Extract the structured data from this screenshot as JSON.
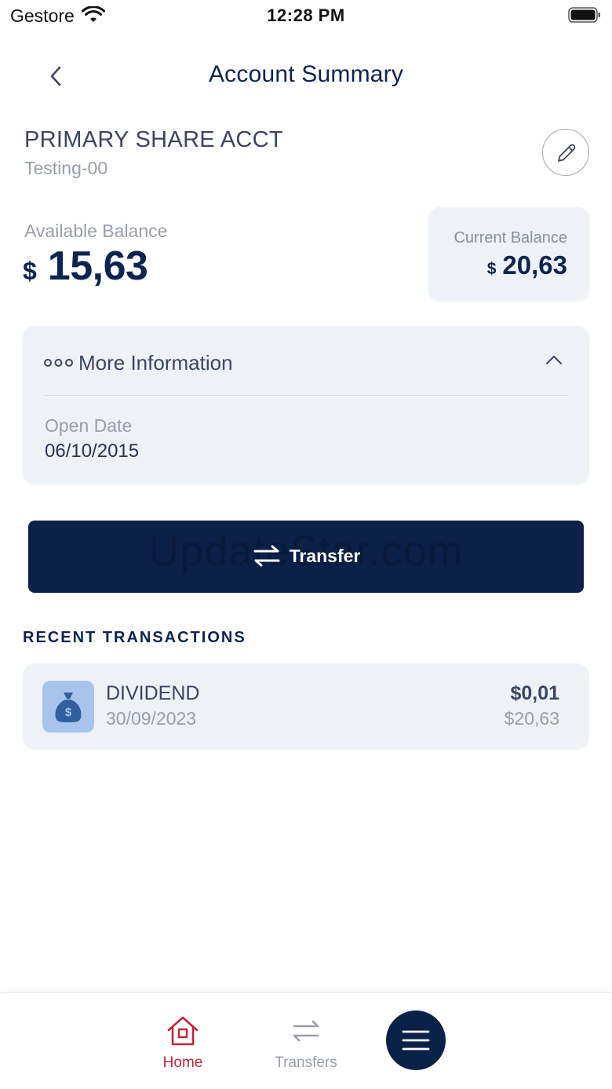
{
  "status_bar": {
    "carrier": "Gestore",
    "time": "12:28 PM"
  },
  "header": {
    "title": "Account Summary"
  },
  "account": {
    "name": "PRIMARY SHARE ACCT",
    "subtitle": "Testing-00"
  },
  "balances": {
    "available_label": "Available Balance",
    "available_currency": "$",
    "available_amount": "15,63",
    "current_label": "Current Balance",
    "current_currency": "$",
    "current_amount": "20,63"
  },
  "more_info": {
    "title": "More Information",
    "expanded": true,
    "open_date_label": "Open Date",
    "open_date_value": "06/10/2015"
  },
  "transfer_button": {
    "label": "Transfer",
    "watermark": "UpdateStar.com"
  },
  "recent": {
    "title": "RECENT TRANSACTIONS",
    "items": [
      {
        "name": "DIVIDEND",
        "date": "30/09/2023",
        "amount": "$0,01",
        "balance": "$20,63",
        "icon": "money-bag-icon"
      }
    ]
  },
  "bottom_nav": {
    "items": [
      {
        "label": "Home",
        "icon": "home-icon",
        "active": true
      },
      {
        "label": "Transfers",
        "icon": "transfers-icon",
        "active": false
      }
    ],
    "menu_icon": "hamburger-icon"
  },
  "colors": {
    "navy": "#0c2148",
    "card_bg": "#eef2f7",
    "active_red": "#c0263a",
    "muted_gray": "#9a9ea8",
    "icon_tile": "#a8c4ec"
  }
}
